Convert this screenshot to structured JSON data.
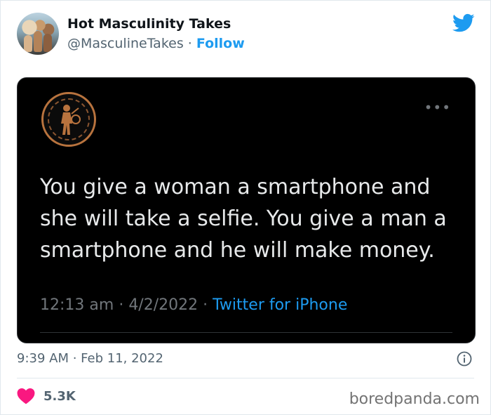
{
  "author": {
    "name": "Hot Masculinity Takes",
    "handle": "@MasculineTakes",
    "separator": "·",
    "follow_label": "Follow"
  },
  "icons": {
    "brand": "twitter-bird-icon",
    "more": "more-options-icon",
    "info": "info-icon",
    "like": "heart-icon"
  },
  "embedded_tweet": {
    "text": "You give a woman a smartphone and she will take a selfie. You give a man a smartphone and he will make money.",
    "time": "12:13 am",
    "date": "4/2/2022",
    "source": "Twitter for iPhone",
    "more_glyph": "•••"
  },
  "footer": {
    "timestamp": "9:39 AM · Feb 11, 2022",
    "likes": "5.3K"
  },
  "watermark": "boredpanda.com",
  "colors": {
    "accent": "#1d9bf0",
    "like": "#f91880",
    "card_bg": "#000000"
  }
}
